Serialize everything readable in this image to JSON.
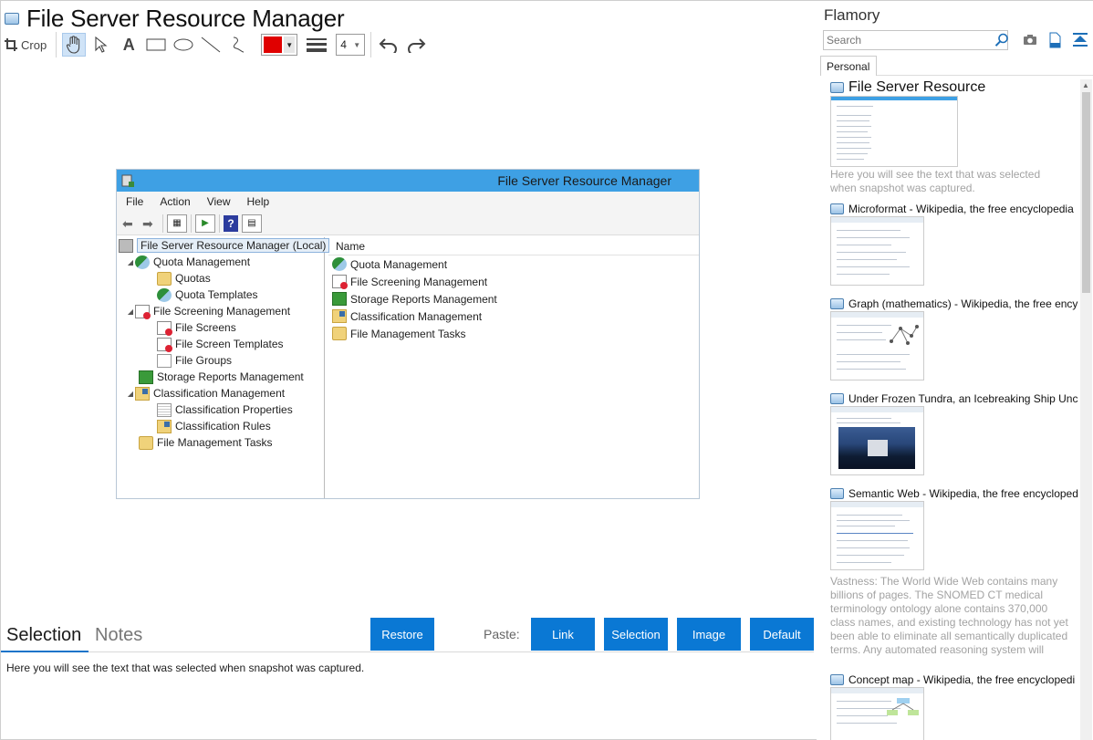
{
  "window": {
    "title": "File Server Resource Manager"
  },
  "toolbar": {
    "crop_label": "Crop",
    "text_tool_glyph": "A",
    "line_width_value": "4",
    "pen_color": "#e00000"
  },
  "snapshot": {
    "title": "File Server Resource Manager",
    "menu": [
      "File",
      "Action",
      "View",
      "Help"
    ],
    "tree": [
      {
        "label": "File Server Resource Manager (Local)",
        "icon": "server-icon"
      },
      {
        "label": "Quota Management",
        "icon": "quota-icon"
      },
      {
        "label": "Quotas",
        "icon": "folder-icon"
      },
      {
        "label": "Quota Templates",
        "icon": "quota-icon"
      },
      {
        "label": "File Screening Management",
        "icon": "screen-icon"
      },
      {
        "label": "File Screens",
        "icon": "screen-icon"
      },
      {
        "label": "File Screen Templates",
        "icon": "screen-icon"
      },
      {
        "label": "File Groups",
        "icon": "page-icon"
      },
      {
        "label": "Storage Reports Management",
        "icon": "reports-icon"
      },
      {
        "label": "Classification Management",
        "icon": "classify-icon"
      },
      {
        "label": "Classification Properties",
        "icon": "props-icon"
      },
      {
        "label": "Classification Rules",
        "icon": "classify-icon"
      },
      {
        "label": "File Management Tasks",
        "icon": "folder-icon"
      }
    ],
    "list_header": "Name",
    "list": [
      {
        "label": "Quota Management",
        "icon": "quota-icon"
      },
      {
        "label": "File Screening Management",
        "icon": "screen-icon"
      },
      {
        "label": "Storage Reports Management",
        "icon": "reports-icon"
      },
      {
        "label": "Classification Management",
        "icon": "classify-icon"
      },
      {
        "label": "File Management Tasks",
        "icon": "folder-icon"
      }
    ]
  },
  "bottom": {
    "tab_selection": "Selection",
    "tab_notes": "Notes",
    "restore_label": "Restore",
    "paste_label": "Paste:",
    "paste_link": "Link",
    "paste_selection": "Selection",
    "paste_image": "Image",
    "paste_default": "Default",
    "notes_text": "Here you will see the text that was selected when snapshot was captured."
  },
  "flamory": {
    "title": "Flamory",
    "search_placeholder": "Search",
    "tab_personal": "Personal",
    "items": [
      {
        "title": "File Server Resource",
        "desc": "Here you will see the text that was selected when snapshot was captured."
      },
      {
        "title": "Microformat - Wikipedia, the free encyclopedia"
      },
      {
        "title": "Graph (mathematics) - Wikipedia, the free ency"
      },
      {
        "title": "Under Frozen Tundra, an Icebreaking Ship Unco"
      },
      {
        "title": "Semantic Web - Wikipedia, the free encycloped",
        "desc": "Vastness: The World Wide Web contains many billions of pages. The SNOMED CT medical terminology ontology alone contains 370,000 class names, and existing technology has not yet been able to eliminate all semantically duplicated terms. Any automated reasoning system will have to deal with truly huge inputs."
      },
      {
        "title": "Concept map - Wikipedia, the free encyclopedi"
      }
    ]
  },
  "colors": {
    "accent": "#0a78d4",
    "snap_titlebar": "#3ea0e4"
  }
}
